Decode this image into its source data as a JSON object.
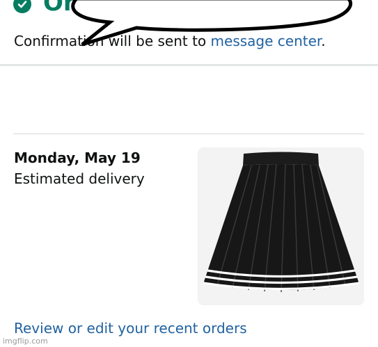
{
  "header": {
    "title_fragment": "Or",
    "confirmation_text": "Confirmation will be sent to ",
    "message_center_link": "message center",
    "period": "."
  },
  "delivery": {
    "date": "Monday, May 19",
    "label": "Estimated delivery"
  },
  "links": {
    "review_orders": "Review or edit your recent orders"
  },
  "watermark": "imgflip.com",
  "colors": {
    "accent_green": "#067d62",
    "link_blue": "#2162a1",
    "divider": "#e3e6e6"
  },
  "icons": {
    "status": "check-circle-icon",
    "product": "pleated-skirt-image"
  }
}
